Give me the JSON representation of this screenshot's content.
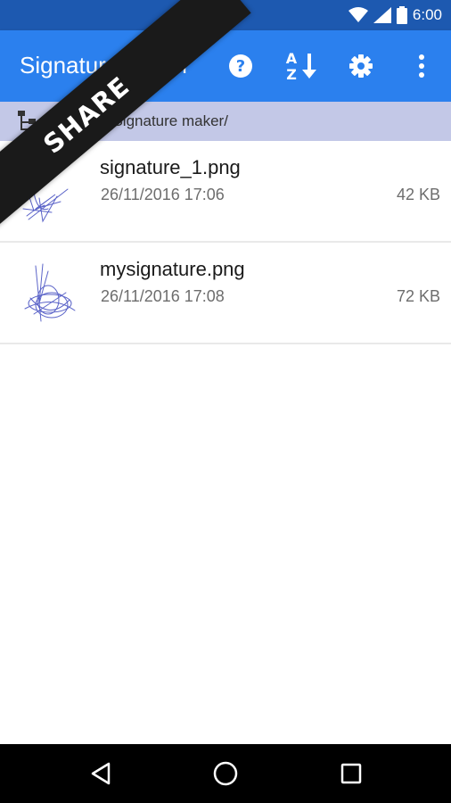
{
  "status_bar": {
    "time": "6:00",
    "icons": [
      "wifi-icon",
      "cell-signal-icon",
      "battery-icon"
    ]
  },
  "app_bar": {
    "title": "Signature maker",
    "actions": [
      "help-icon",
      "sort-az-icon",
      "settings-icon",
      "overflow-menu-icon"
    ],
    "sort_label_top": "A",
    "sort_label_bottom": "Z",
    "help_label": "?"
  },
  "path_bar": {
    "path": "/sdcard/Signature maker/",
    "icon": "folder-tree-icon"
  },
  "files": [
    {
      "name": "signature_1.png",
      "date": "26/11/2016 17:06",
      "size": "42 KB",
      "thumb": "signature-thumbnail"
    },
    {
      "name": "mysignature.png",
      "date": "26/11/2016 17:08",
      "size": "72 KB",
      "thumb": "signature-thumbnail"
    }
  ],
  "banner": {
    "label": "SHARE"
  },
  "nav_bar": {
    "buttons": [
      "back-icon",
      "home-icon",
      "recents-icon"
    ]
  },
  "colors": {
    "status_bar": "#1d59b0",
    "app_bar": "#2b80ee",
    "path_bar": "#c3c8e7",
    "signature_ink": "#5a63c8",
    "banner": "#1a1a1a"
  }
}
